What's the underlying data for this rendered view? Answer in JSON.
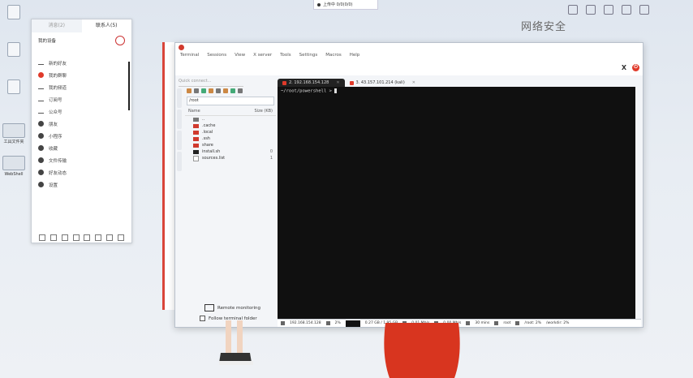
{
  "app": {
    "menu": [
      "Terminal",
      "Sessions",
      "View",
      "X server",
      "Tools",
      "Settings",
      "Macros",
      "Help"
    ],
    "quick_connect_placeholder": "Quick connect...",
    "sftp": {
      "path": "/root",
      "col_name": "Name",
      "col_size": "Size (KB)",
      "files": [
        {
          "name": "..",
          "size": "",
          "kind": "up"
        },
        {
          "name": ".cache",
          "size": "",
          "kind": "folder"
        },
        {
          "name": ".local",
          "size": "",
          "kind": "folder"
        },
        {
          "name": ".ssh",
          "size": "",
          "kind": "folder"
        },
        {
          "name": "share",
          "size": "",
          "kind": "folder"
        },
        {
          "name": "install.sh",
          "size": "0",
          "kind": "script"
        },
        {
          "name": "sources.list",
          "size": "1",
          "kind": "doc"
        }
      ],
      "remote_monitoring": "Remote monitoring",
      "follow_terminal": "Follow terminal folder"
    },
    "tabs": [
      {
        "label": "2. 192.168.154.128",
        "active": true
      },
      {
        "label": "3. 43.157.101.214 (kali)",
        "active": false
      }
    ],
    "terminal": {
      "prompt": "~/root/powershell > "
    },
    "statusbar": {
      "host": "192.168.154.128",
      "cpu": "2%",
      "net": "0.27 GB / 1.95 GB",
      "up": "0.01 Mb/s",
      "down": "0.00 Mb/s",
      "time": "30 mins",
      "user": "root",
      "path": "/root: 2%",
      "avail": "/workdir: 2%"
    }
  },
  "im_panel": {
    "tabs": [
      "消息(2)",
      "联系人(5)"
    ],
    "user": "我的设备",
    "items": [
      "新的好友",
      "我的群聊",
      "我的频道",
      "订阅号",
      "公众号",
      "朋友",
      "小程序",
      "收藏",
      "文件传输",
      "好友动态",
      "设置"
    ]
  },
  "desktop": {
    "icons": [
      "",
      "",
      "",
      "工具文件夹",
      "WebShell"
    ],
    "watermark": "网络安全"
  },
  "top_bar": {
    "label": "上传中 0/0(0/0)"
  }
}
